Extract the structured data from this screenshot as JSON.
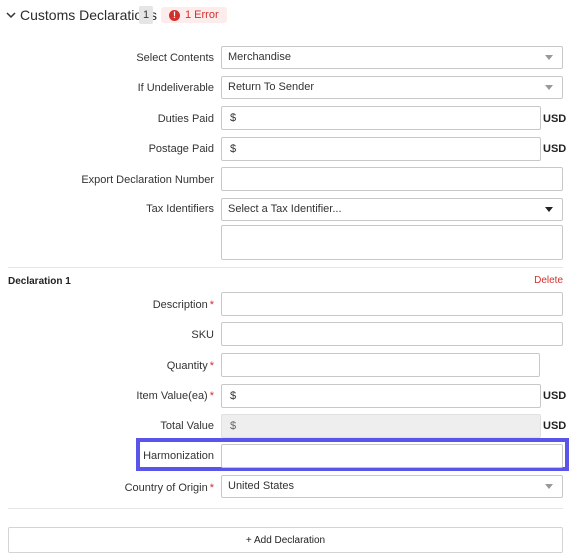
{
  "header": {
    "title": "Customs Declarations",
    "count": "1",
    "error_icon": "!",
    "error_label": "1 Error"
  },
  "customs": {
    "select_contents": {
      "label": "Select Contents",
      "value": "Merchandise"
    },
    "if_undeliverable": {
      "label": "If Undeliverable",
      "value": "Return To Sender"
    },
    "duties_paid": {
      "label": "Duties Paid",
      "prefix": "$",
      "currency": "USD"
    },
    "postage_paid": {
      "label": "Postage Paid",
      "prefix": "$",
      "currency": "USD"
    },
    "export_declaration": {
      "label": "Export Declaration Number"
    },
    "tax_identifiers": {
      "label": "Tax Identifiers",
      "placeholder": "Select a Tax Identifier..."
    }
  },
  "declaration": {
    "title": "Declaration 1",
    "delete_label": "Delete",
    "required_mark": "*",
    "description": {
      "label": "Description"
    },
    "sku": {
      "label": "SKU"
    },
    "quantity": {
      "label": "Quantity"
    },
    "item_value": {
      "label": "Item Value(ea)",
      "prefix": "$",
      "currency": "USD"
    },
    "total_value": {
      "label": "Total Value",
      "prefix": "$",
      "currency": "USD"
    },
    "harmonization": {
      "label": "Harmonization"
    },
    "country_of_origin": {
      "label": "Country of Origin",
      "value": "United States"
    }
  },
  "add_declaration": {
    "label": "+ Add Declaration"
  },
  "colors": {
    "error": "#d0312d",
    "highlight": "#5b54e8"
  }
}
